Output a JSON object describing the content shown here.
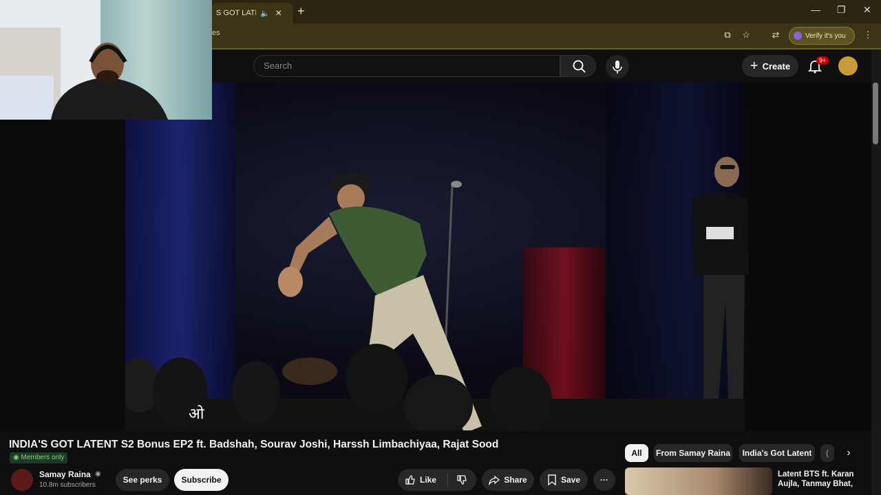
{
  "browser": {
    "tab_title": "S GOT LATENT",
    "url_fragment": "es",
    "verify_label": "Verify it's you"
  },
  "youtube": {
    "search_placeholder": "Search",
    "create_label": "Create",
    "notif_badge": "9+"
  },
  "video": {
    "subtitle": "ओ",
    "title": "INDIA'S GOT LATENT S2 Bonus EP2 ft. Badshah, Sourav Joshi, Harssh Limbachiyaa, Rajat Sood",
    "members_badge": "Members only"
  },
  "channel": {
    "name": "Samay Raina",
    "subscribers": "10.8m subscribers",
    "see_perks_label": "See perks",
    "subscribe_label": "Subscribe"
  },
  "actions": {
    "like_label": "Like",
    "share_label": "Share",
    "save_label": "Save"
  },
  "chips": [
    "All",
    "From Samay Raina",
    "India's Got Latent",
    "("
  ],
  "recommended": {
    "title": "Latent BTS ft. Karan Aujla, Tanmay Bhat,"
  }
}
